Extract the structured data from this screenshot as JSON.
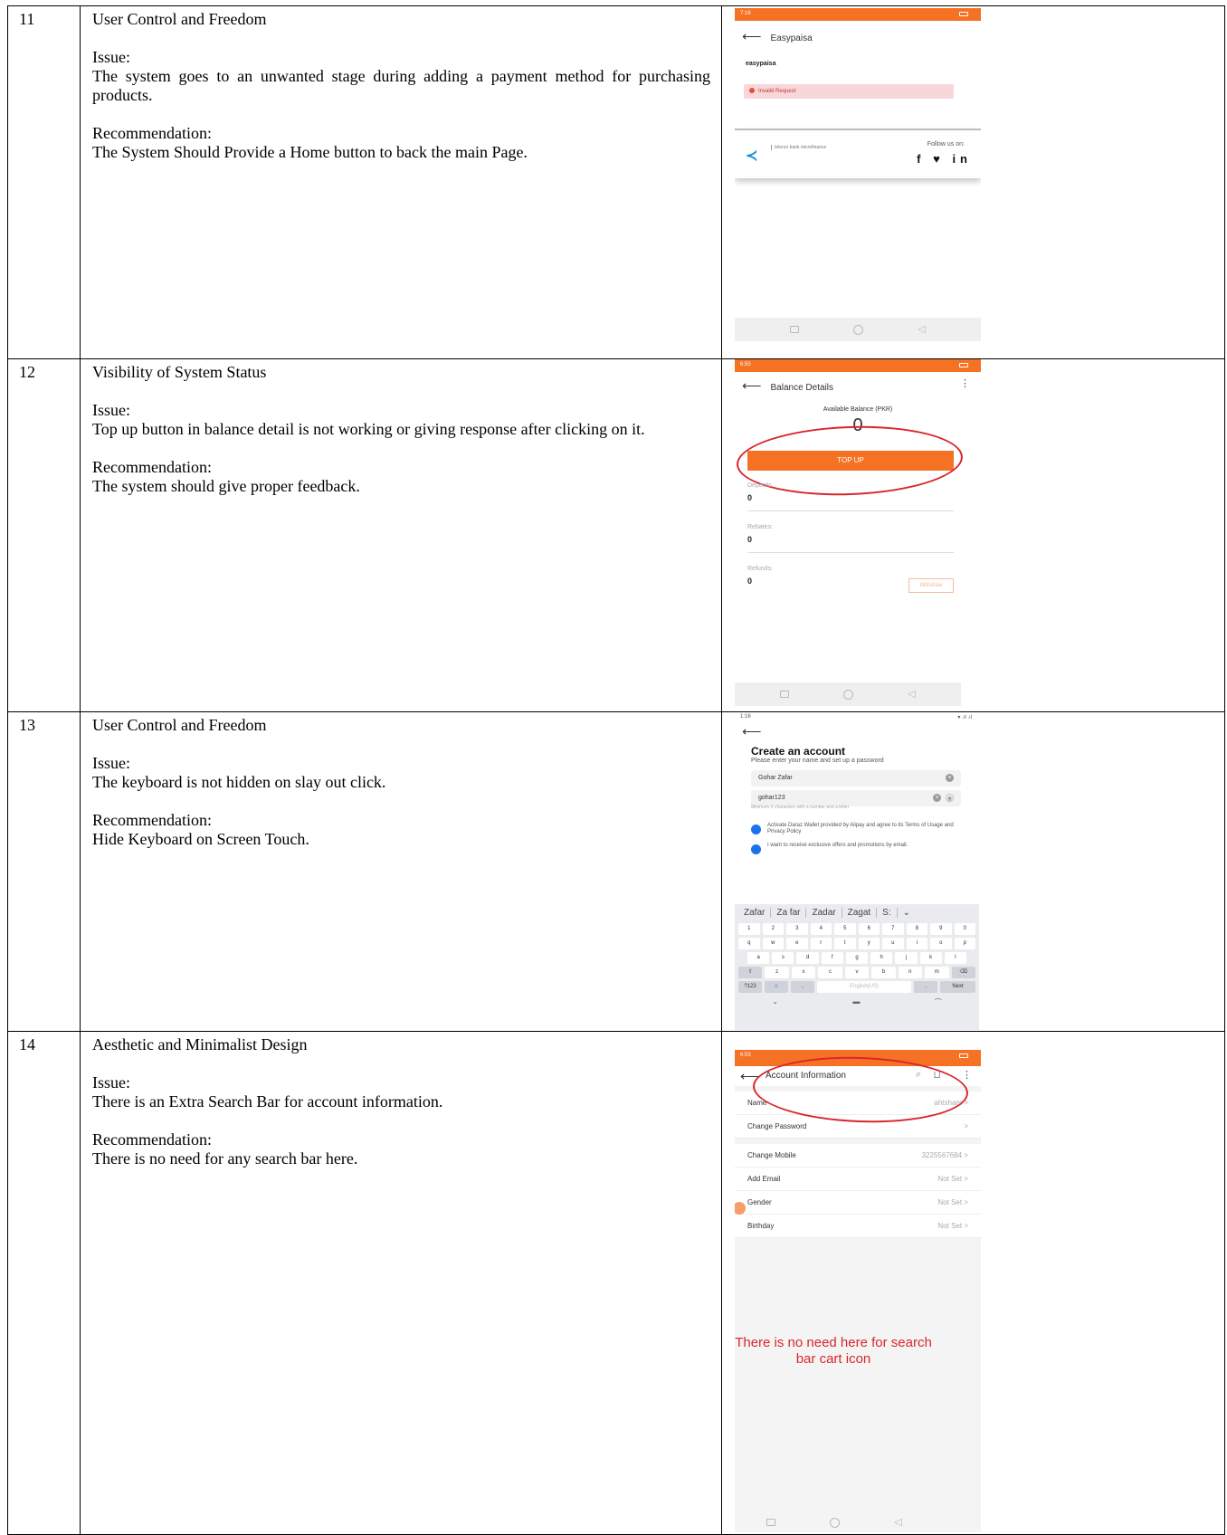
{
  "rows": [
    {
      "num": "11",
      "heading": "User Control and Freedom",
      "issue_label": "Issue:",
      "issue": "The system goes to an unwanted stage during adding a payment method for purchasing products.",
      "rec_label": "Recommendation:",
      "rec": "The System Should Provide a Home button to back the main Page.",
      "screen": {
        "status_time": "7:16",
        "title": "Easypaisa",
        "logo_text": "easypaisa",
        "error": "Invalid Request",
        "bank_logo_text": "telenor bank microfinance",
        "follow": "Follow us on:",
        "socials": "f ♥ in"
      }
    },
    {
      "num": "12",
      "heading": "Visibility of System Status",
      "issue_label": "Issue:",
      "issue": "Top up button in balance detail is not working or giving response after clicking on it.",
      "rec_label": "Recommendation:",
      "rec": "The system should give proper feedback.",
      "screen": {
        "status_time": "6:50",
        "title": "Balance Details",
        "available": "Available Balance (PKR)",
        "balance": "0",
        "topup": "TOP UP",
        "fields": [
          {
            "label": "Deposits",
            "value": "0"
          },
          {
            "label": "Rebates:",
            "value": "0"
          },
          {
            "label": "Refunds:",
            "value": "0"
          }
        ],
        "withdraw": "Withdraw"
      }
    },
    {
      "num": "13",
      "heading": "User Control and Freedom",
      "issue_label": "Issue:",
      "issue": "The keyboard is not hidden on slay out click.",
      "rec_label": "Recommendation:",
      "rec": "Hide Keyboard on Screen Touch.",
      "screen": {
        "status_time": "1:16",
        "status_right": "▾ .ıl .ıl ",
        "title": "Create an account",
        "subtitle": "Please enter your name and set up a password",
        "name_value": "Gohar Zafar",
        "password_value": "gohar123",
        "hint": "Minimum 6 characters with a number and a letter",
        "check1": "Activate Daraz Wallet provided by Alipay and agree to its Terms of Usage and Privacy Policy",
        "check2": "I want to receive exclusive offers and promotions by email.",
        "suggestions": [
          "Zafar",
          "Za far",
          "Zadar",
          "Zagat",
          "S:",
          "⌄"
        ],
        "keys_row1": [
          "1",
          "2",
          "3",
          "4",
          "5",
          "6",
          "7",
          "8",
          "9",
          "0"
        ],
        "keys_row2": [
          "q",
          "w",
          "e",
          "r",
          "t",
          "y",
          "u",
          "i",
          "o",
          "p"
        ],
        "keys_row3": [
          "a",
          "s",
          "d",
          "f",
          "g",
          "h",
          "j",
          "k",
          "l"
        ],
        "keys_row4": [
          "⇧",
          "z",
          "x",
          "c",
          "v",
          "b",
          "n",
          "m",
          "⌫"
        ],
        "keys_row5": [
          "?123",
          "☺",
          ",",
          "English(US)",
          ".",
          "Next"
        ]
      }
    },
    {
      "num": "14",
      "heading": "Aesthetic and Minimalist Design",
      "issue_label": "Issue:",
      "issue": "There is an Extra Search Bar for account information.",
      "rec_label": "Recommendation:",
      "rec": "There is no need for any search bar here.",
      "screen": {
        "status_time": "6:53",
        "title": "Account Information",
        "rows": [
          {
            "label": "Name",
            "value": "ahtsham"
          },
          {
            "label": "Change Password",
            "value": ""
          },
          {
            "label": "Change Mobile",
            "value": "3225567684"
          },
          {
            "label": "Add Email",
            "value": "Not Set"
          },
          {
            "label": "Gender",
            "value": "Not Set"
          },
          {
            "label": "Birthday",
            "value": "Not Set"
          }
        ],
        "annotation": "There is no need here for search bar cart icon"
      }
    }
  ]
}
